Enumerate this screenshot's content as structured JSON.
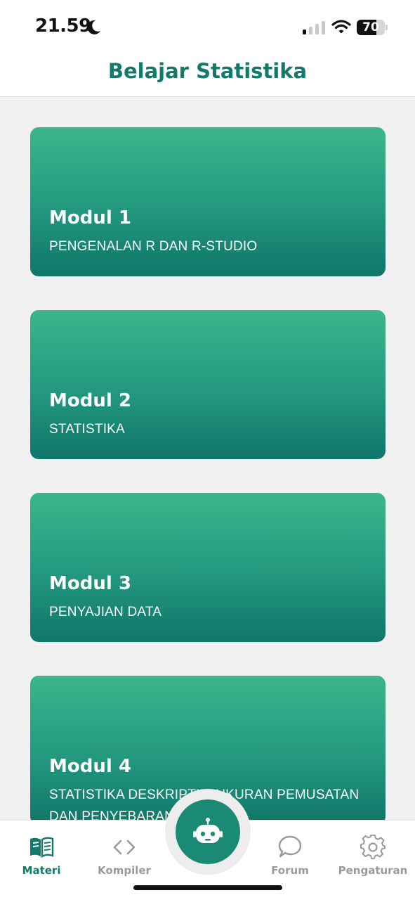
{
  "status_bar": {
    "time": "21.59",
    "battery_level": "70",
    "battery_fraction": 0.7,
    "icons": [
      "moon-icon",
      "signal-icon",
      "wifi-icon",
      "battery-icon"
    ]
  },
  "header": {
    "title": "Belajar Statistika"
  },
  "colors": {
    "brand": "#137a6b",
    "card_gradient_top": "#3cb58b",
    "card_gradient_bottom": "#0f7669",
    "nav_inactive": "#9a9a9a"
  },
  "modules": [
    {
      "title": "Modul 1",
      "subtitle": "PENGENALAN R DAN R-STUDIO"
    },
    {
      "title": "Modul 2",
      "subtitle": "STATISTIKA"
    },
    {
      "title": "Modul 3",
      "subtitle": "PENYAJIAN DATA"
    },
    {
      "title": "Modul 4",
      "subtitle": "STATISTIKA DESKRIPTIF: UKURAN PEMUSATAN DAN PENYEBARAN DATA"
    }
  ],
  "nav": {
    "items": [
      {
        "label": "Materi",
        "icon": "book-icon",
        "active": true
      },
      {
        "label": "Kompiler",
        "icon": "code-icon",
        "active": false
      },
      {
        "label": "Forum",
        "icon": "chat-bubble-icon",
        "active": false
      },
      {
        "label": "Pengaturan",
        "icon": "gear-icon",
        "active": false
      }
    ],
    "center_button_icon": "robot-icon"
  }
}
